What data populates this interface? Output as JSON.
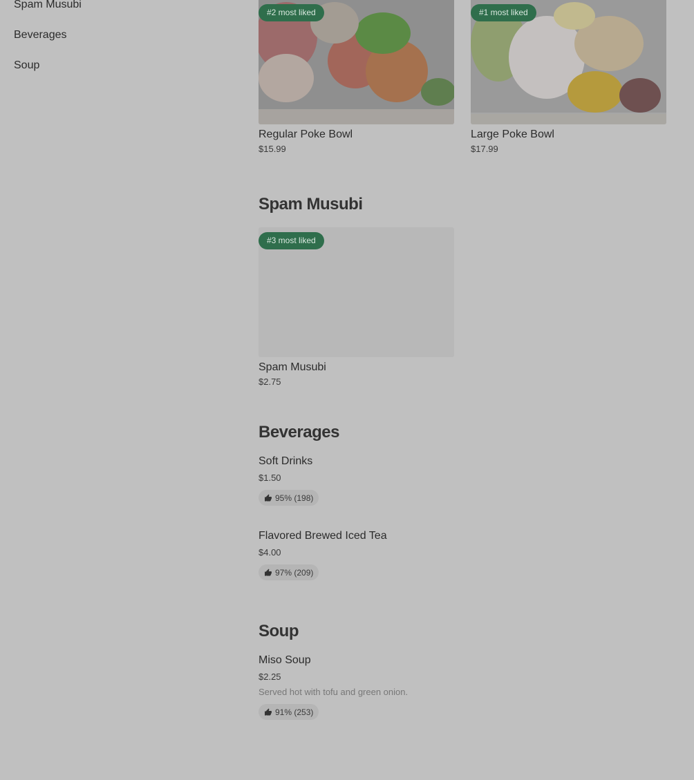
{
  "sidebar": {
    "items": [
      {
        "label": "Spam Musubi"
      },
      {
        "label": "Beverages"
      },
      {
        "label": "Soup"
      }
    ]
  },
  "featured": [
    {
      "badge": "#2 most liked",
      "name": "Regular Poke Bowl",
      "price": "$15.99"
    },
    {
      "badge": "#1 most liked",
      "name": "Large Poke Bowl",
      "price": "$17.99"
    }
  ],
  "sections": {
    "spam": {
      "title": "Spam Musubi",
      "item": {
        "badge": "#3 most liked",
        "name": "Spam Musubi",
        "price": "$2.75"
      }
    },
    "beverages": {
      "title": "Beverages",
      "items": [
        {
          "name": "Soft Drinks",
          "price": "$1.50",
          "rating": "95% (198)"
        },
        {
          "name": "Flavored Brewed Iced Tea",
          "price": "$4.00",
          "rating": "97% (209)"
        }
      ]
    },
    "soup": {
      "title": "Soup",
      "items": [
        {
          "name": "Miso Soup",
          "price": "$2.25",
          "description": "Served hot with tofu and green onion.",
          "rating": "91% (253)"
        }
      ]
    }
  },
  "colors": {
    "background": "#c0c0c0",
    "badge": "#2f6e4c"
  }
}
